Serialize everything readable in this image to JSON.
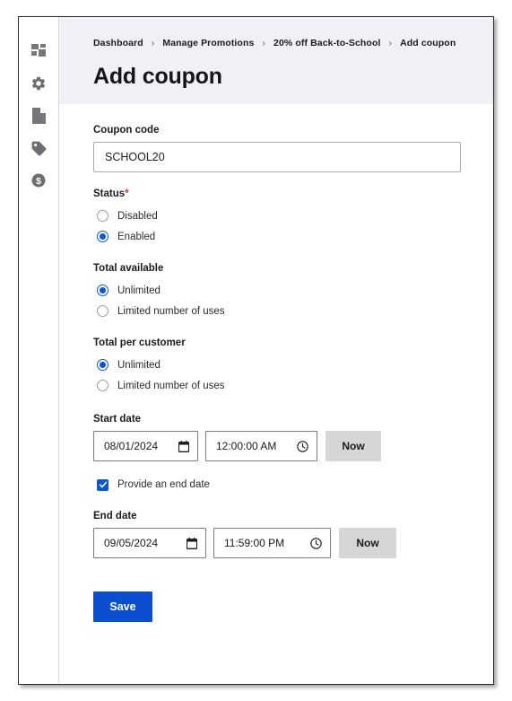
{
  "sidebar": {
    "items": [
      {
        "icon": "dashboard-grid-icon",
        "name": "sidebar-item-dashboard"
      },
      {
        "icon": "gear-icon",
        "name": "sidebar-item-settings"
      },
      {
        "icon": "document-page-icon",
        "name": "sidebar-item-catalog"
      },
      {
        "icon": "tag-icon",
        "name": "sidebar-item-promotions"
      },
      {
        "icon": "dollar-circle-icon",
        "name": "sidebar-item-billing"
      }
    ]
  },
  "header": {
    "breadcrumb": [
      "Dashboard",
      "Manage Promotions",
      "20% off Back-to-School",
      "Add coupon"
    ],
    "separator": "›",
    "title": "Add coupon"
  },
  "form": {
    "coupon_code": {
      "label": "Coupon code",
      "value": "SCHOOL20",
      "placeholder": ""
    },
    "status": {
      "label": "Status",
      "required_marker": "*",
      "options": [
        "Disabled",
        "Enabled"
      ],
      "selected": "Enabled"
    },
    "total_available": {
      "label": "Total available",
      "options": [
        "Unlimited",
        "Limited number of uses"
      ],
      "selected": "Unlimited"
    },
    "total_per_customer": {
      "label": "Total per customer",
      "options": [
        "Unlimited",
        "Limited number of uses"
      ],
      "selected": "Unlimited"
    },
    "start_date": {
      "label": "Start date",
      "date": "08/01/2024",
      "time": "12:00:00 AM",
      "now_label": "Now",
      "date_icon": "calendar-icon",
      "time_icon": "clock-icon"
    },
    "end_date_toggle": {
      "label": "Provide an end date",
      "checked": true
    },
    "end_date": {
      "label": "End date",
      "date": "09/05/2024",
      "time": "11:59:00 PM",
      "now_label": "Now",
      "date_icon": "calendar-icon",
      "time_icon": "clock-icon"
    },
    "save_label": "Save"
  },
  "colors": {
    "accent_blue": "#0b57d0",
    "save_blue": "#0b4fd0",
    "required_red": "#d93025",
    "header_band": "#eff1f6",
    "now_button_grey": "#d6d6d9"
  }
}
